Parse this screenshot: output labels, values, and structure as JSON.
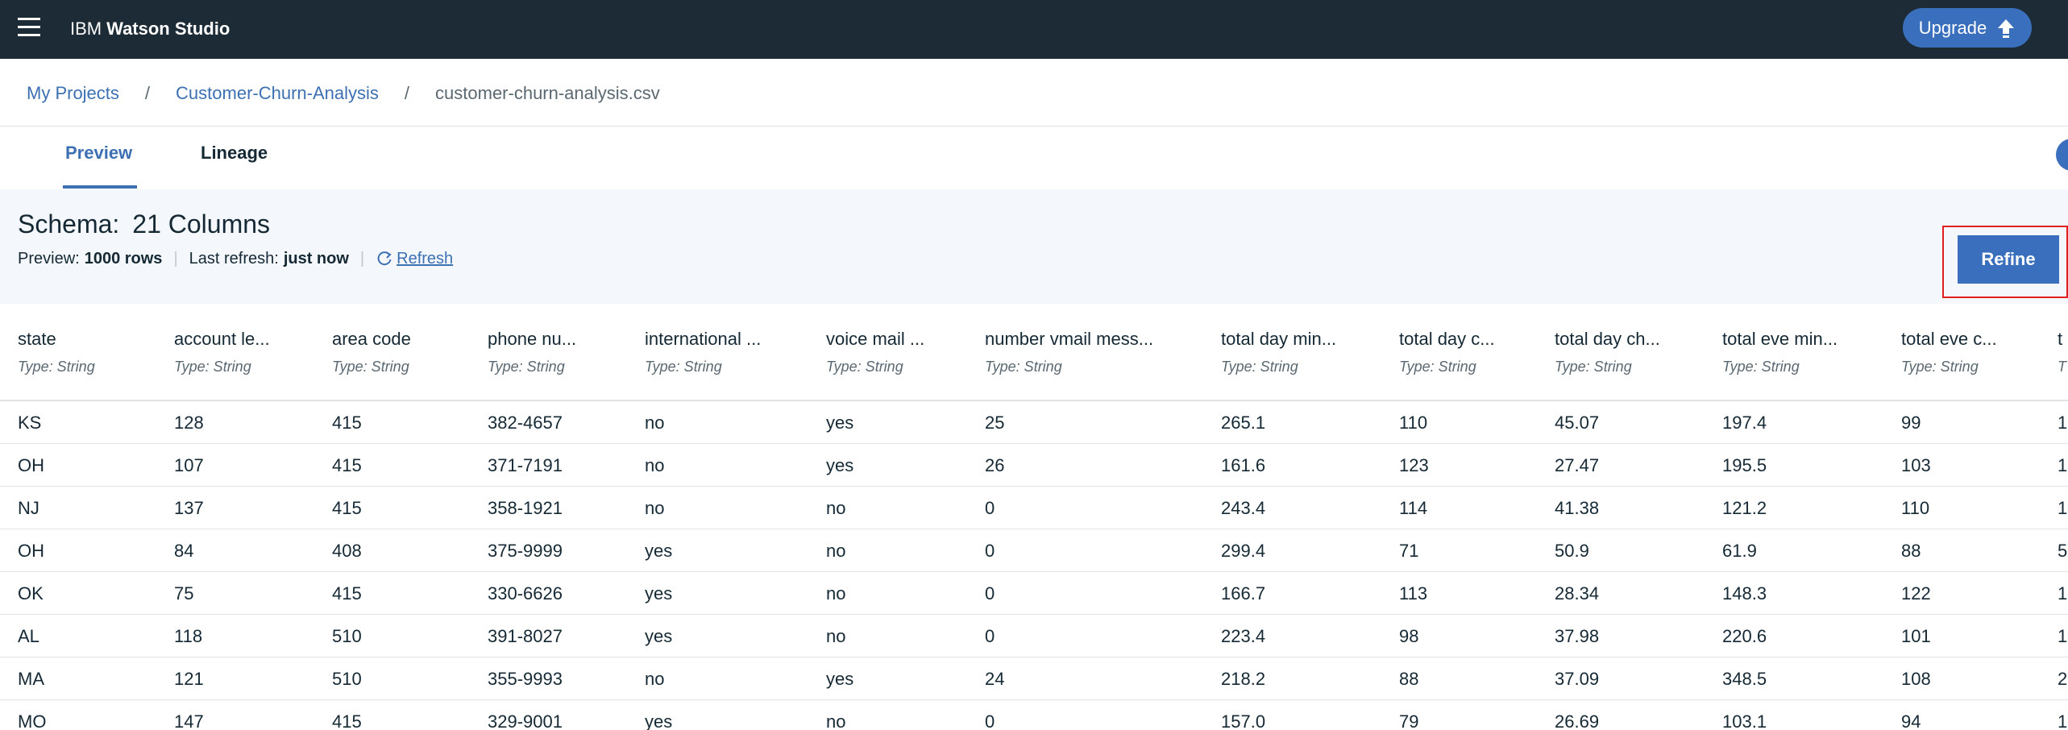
{
  "topbar": {
    "brand_ibm": "IBM",
    "brand_product": "Watson Studio",
    "upgrade_label": "Upgrade"
  },
  "breadcrumb": {
    "items": [
      "My Projects",
      "Customer-Churn-Analysis",
      "customer-churn-analysis.csv"
    ],
    "separator": "/"
  },
  "tabs": [
    {
      "label": "Preview",
      "active": true
    },
    {
      "label": "Lineage",
      "active": false
    }
  ],
  "schema": {
    "label": "Schema:",
    "columns_text": "21 Columns",
    "preview_label": "Preview:",
    "preview_value": "1000 rows",
    "refresh_label": "Last refresh:",
    "refresh_value": "just now",
    "refresh_link": "Refresh",
    "separator": "|"
  },
  "refine_label": "Refine",
  "table": {
    "columns": [
      {
        "name": "state",
        "type": "Type: String"
      },
      {
        "name": "account le...",
        "type": "Type: String"
      },
      {
        "name": "area code",
        "type": "Type: String"
      },
      {
        "name": "phone nu...",
        "type": "Type: String"
      },
      {
        "name": "international ...",
        "type": "Type: String"
      },
      {
        "name": "voice mail ...",
        "type": "Type: String"
      },
      {
        "name": "number vmail mess...",
        "type": "Type: String"
      },
      {
        "name": "total day min...",
        "type": "Type: String"
      },
      {
        "name": "total day c...",
        "type": "Type: String"
      },
      {
        "name": "total day ch...",
        "type": "Type: String"
      },
      {
        "name": "total eve min...",
        "type": "Type: String"
      },
      {
        "name": "total eve c...",
        "type": "Type: String"
      },
      {
        "name": "t",
        "type": "T"
      }
    ],
    "rows": [
      [
        "KS",
        "128",
        "415",
        "382-4657",
        "no",
        "yes",
        "25",
        "265.1",
        "110",
        "45.07",
        "197.4",
        "99",
        "1"
      ],
      [
        "OH",
        "107",
        "415",
        "371-7191",
        "no",
        "yes",
        "26",
        "161.6",
        "123",
        "27.47",
        "195.5",
        "103",
        "1"
      ],
      [
        "NJ",
        "137",
        "415",
        "358-1921",
        "no",
        "no",
        "0",
        "243.4",
        "114",
        "41.38",
        "121.2",
        "110",
        "1"
      ],
      [
        "OH",
        "84",
        "408",
        "375-9999",
        "yes",
        "no",
        "0",
        "299.4",
        "71",
        "50.9",
        "61.9",
        "88",
        "5"
      ],
      [
        "OK",
        "75",
        "415",
        "330-6626",
        "yes",
        "no",
        "0",
        "166.7",
        "113",
        "28.34",
        "148.3",
        "122",
        "1"
      ],
      [
        "AL",
        "118",
        "510",
        "391-8027",
        "yes",
        "no",
        "0",
        "223.4",
        "98",
        "37.98",
        "220.6",
        "101",
        "1"
      ],
      [
        "MA",
        "121",
        "510",
        "355-9993",
        "no",
        "yes",
        "24",
        "218.2",
        "88",
        "37.09",
        "348.5",
        "108",
        "2"
      ],
      [
        "MO",
        "147",
        "415",
        "329-9001",
        "yes",
        "no",
        "0",
        "157.0",
        "79",
        "26.69",
        "103.1",
        "94",
        "1"
      ]
    ]
  }
}
